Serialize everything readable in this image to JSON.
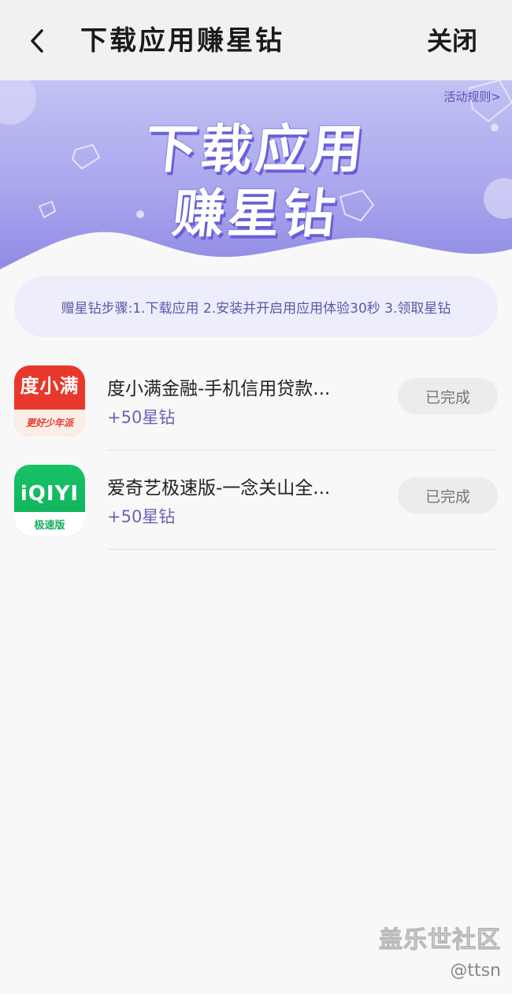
{
  "header": {
    "title": "下载应用赚星钻",
    "close_label": "关闭"
  },
  "banner": {
    "rules_link": "活动规则>",
    "title_line1": "下载应用",
    "title_line2": "赚星钻"
  },
  "steps_text": "赠星钻步骤:1.下载应用 2.安装并开启用应用体验30秒 3.领取星钻",
  "apps": [
    {
      "name": "度小满金融-手机信用贷款...",
      "reward": "+50星钻",
      "button": "已完成",
      "icon_top": "度小满",
      "icon_bottom": "更好少年派"
    },
    {
      "name": "爱奇艺极速版-一念关山全...",
      "reward": "+50星钻",
      "button": "已完成",
      "icon_top": "iQIYI",
      "icon_bottom": "极速版"
    }
  ],
  "watermark": {
    "line1": "盖乐世社区",
    "line2": "@ttsn"
  },
  "colors": {
    "accent": "#6b63b4",
    "banner_start": "#c2c2f4",
    "banner_end": "#8d89e3"
  }
}
